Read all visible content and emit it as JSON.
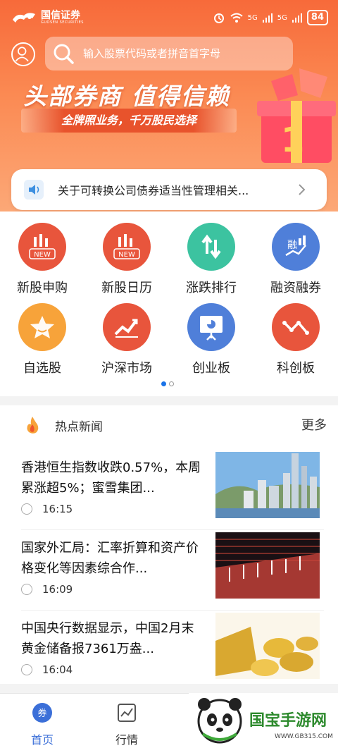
{
  "status_bar": {
    "brand_name": "国信证券",
    "brand_sub": "GUOSEN SECURITIES",
    "network_labels": [
      "5G",
      "5G"
    ],
    "battery": "84"
  },
  "search": {
    "placeholder": "输入股票代码或者拼音首字母"
  },
  "banner": {
    "title": "头部券商  值得信赖",
    "subtitle": "全牌照业务，千万股民选择"
  },
  "notice": {
    "text": "关于可转换公司债券适当性管理相关..."
  },
  "grid": {
    "items": [
      {
        "label": "新股申购",
        "color": "#e8553c",
        "icon": "new-stock-icon",
        "badge": "NEW"
      },
      {
        "label": "新股日历",
        "color": "#e8553c",
        "icon": "new-stock-calendar-icon",
        "badge": "NEW"
      },
      {
        "label": "涨跌排行",
        "color": "#3cc3a0",
        "icon": "up-down-arrows-icon"
      },
      {
        "label": "融资融券",
        "color": "#4f7fd9",
        "icon": "margin-trading-icon"
      },
      {
        "label": "自选股",
        "color": "#f7a33a",
        "icon": "star-icon"
      },
      {
        "label": "沪深市场",
        "color": "#e8553c",
        "icon": "trend-chart-icon"
      },
      {
        "label": "创业板",
        "color": "#4f7fd9",
        "icon": "presentation-board-icon"
      },
      {
        "label": "科创板",
        "color": "#e8553c",
        "icon": "line-chart-icon"
      }
    ],
    "page_count": 2,
    "active_page": 0
  },
  "news": {
    "title": "热点新闻",
    "more": "更多",
    "items": [
      {
        "headline": "香港恒生指数收跌0.57%，本周累涨超5%；蜜雪集团...",
        "time": "16:15",
        "thumb": "city-skyline-image"
      },
      {
        "headline": "国家外汇局：汇率折算和资产价格变化等因素综合作...",
        "time": "16:09",
        "thumb": "currency-chart-image"
      },
      {
        "headline": "中国央行数据显示，中国2月末黄金储备报7361万盎...",
        "time": "16:04",
        "thumb": "gold-coins-image"
      }
    ]
  },
  "tabbar": {
    "tabs": [
      {
        "label": "首页",
        "icon": "home-coupon-icon",
        "active": true
      },
      {
        "label": "行情",
        "icon": "market-chart-icon",
        "active": false
      }
    ]
  },
  "watermark": {
    "text": "国宝手游网",
    "url": "WWW.GB315.COM"
  },
  "colors": {
    "accent": "#f76a3a",
    "active_tab": "#3b6fd8"
  }
}
